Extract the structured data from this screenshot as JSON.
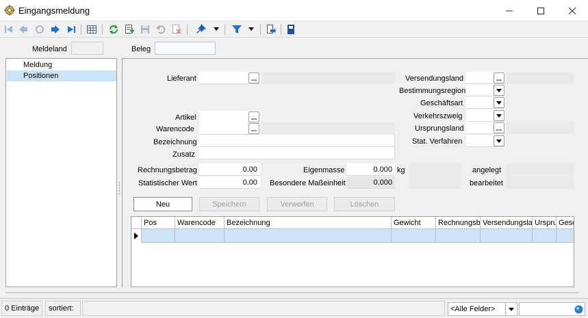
{
  "window": {
    "title": "Eingangsmeldung"
  },
  "toolbar": {
    "icons": [
      "first-record-icon",
      "previous-record-icon",
      "refresh-back-icon",
      "next-record-icon",
      "last-record-icon",
      "table-view-icon",
      "reload-icon",
      "new-record-icon",
      "save-icon",
      "undo-icon",
      "delete-icon",
      "pin-icon",
      "filter-icon",
      "export-icon",
      "book-icon"
    ]
  },
  "header": {
    "meldeland_label": "Meldeland",
    "meldeland_value": "",
    "beleg_label": "Beleg",
    "beleg_value": ""
  },
  "nav": {
    "items": [
      {
        "label": "Meldung",
        "selected": false
      },
      {
        "label": "Positionen",
        "selected": true
      }
    ]
  },
  "form": {
    "lieferant_label": "Lieferant",
    "artikel_label": "Artikel",
    "warencode_label": "Warencode",
    "bezeichnung_label": "Bezeichnung",
    "zusatz_label": "Zusatz",
    "versendungsland_label": "Versendungsland",
    "bestimmungsregion_label": "Bestimmungsregion",
    "geschaeftsart_label": "Geschäftsart",
    "verkehrszweig_label": "Verkehrszweig",
    "ursprungsland_label": "Ursprungsland",
    "stat_verfahren_label": "Stat. Verfahren",
    "rechnungsbetrag_label": "Rechnungsbetrag",
    "rechnungsbetrag_value": "0.00",
    "statistischer_wert_label": "Statistischer Wert",
    "statistischer_wert_value": "0.00",
    "eigenmasse_label": "Eigenmasse",
    "eigenmasse_value": "0.000",
    "eigenmasse_unit": "kg",
    "besondere_masseinheit_label": "Besondere Maßeinheit",
    "besondere_masseinheit_value": "0.000",
    "angelegt_label": "angelegt",
    "bearbeitet_label": "bearbeitet",
    "dots_label": "..."
  },
  "buttons": {
    "neu": "Neu",
    "speichern": "Speichern",
    "verwerfen": "Verwerfen",
    "loeschen": "Löschen"
  },
  "grid": {
    "columns": [
      "Pos",
      "Warencode",
      "Bezeichnung",
      "Gewicht",
      "Rechnungsbe",
      "Versendungslar",
      "Ursprur",
      "Gesc"
    ]
  },
  "status": {
    "entries": "0 Einträge",
    "sorted": "sortiert:",
    "field_selector": "<Alle Felder>"
  }
}
